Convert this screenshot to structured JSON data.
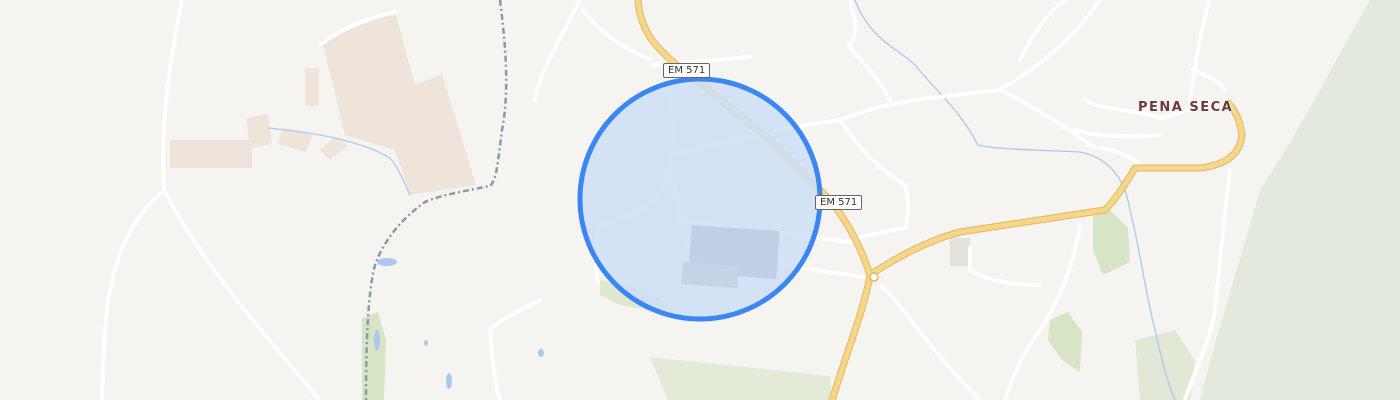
{
  "map": {
    "road_labels": [
      "EM 571",
      "EM 571"
    ],
    "place_labels": [
      "PENA SECA"
    ],
    "colors": {
      "background": "#f6f4f0",
      "minor_road": "#ffffff",
      "major_road": "#f7d68a",
      "major_road_casing": "#e0b860",
      "water": "#a9c8ee",
      "park": "#dde8cf",
      "hills": "#e4e9de",
      "building": "#eee4da",
      "boundary": "#8d97aa",
      "location_fill": "#cddff6",
      "location_stroke": "#3b86f2"
    },
    "icons": {
      "location_marker": "location-accuracy-circle-icon"
    }
  }
}
